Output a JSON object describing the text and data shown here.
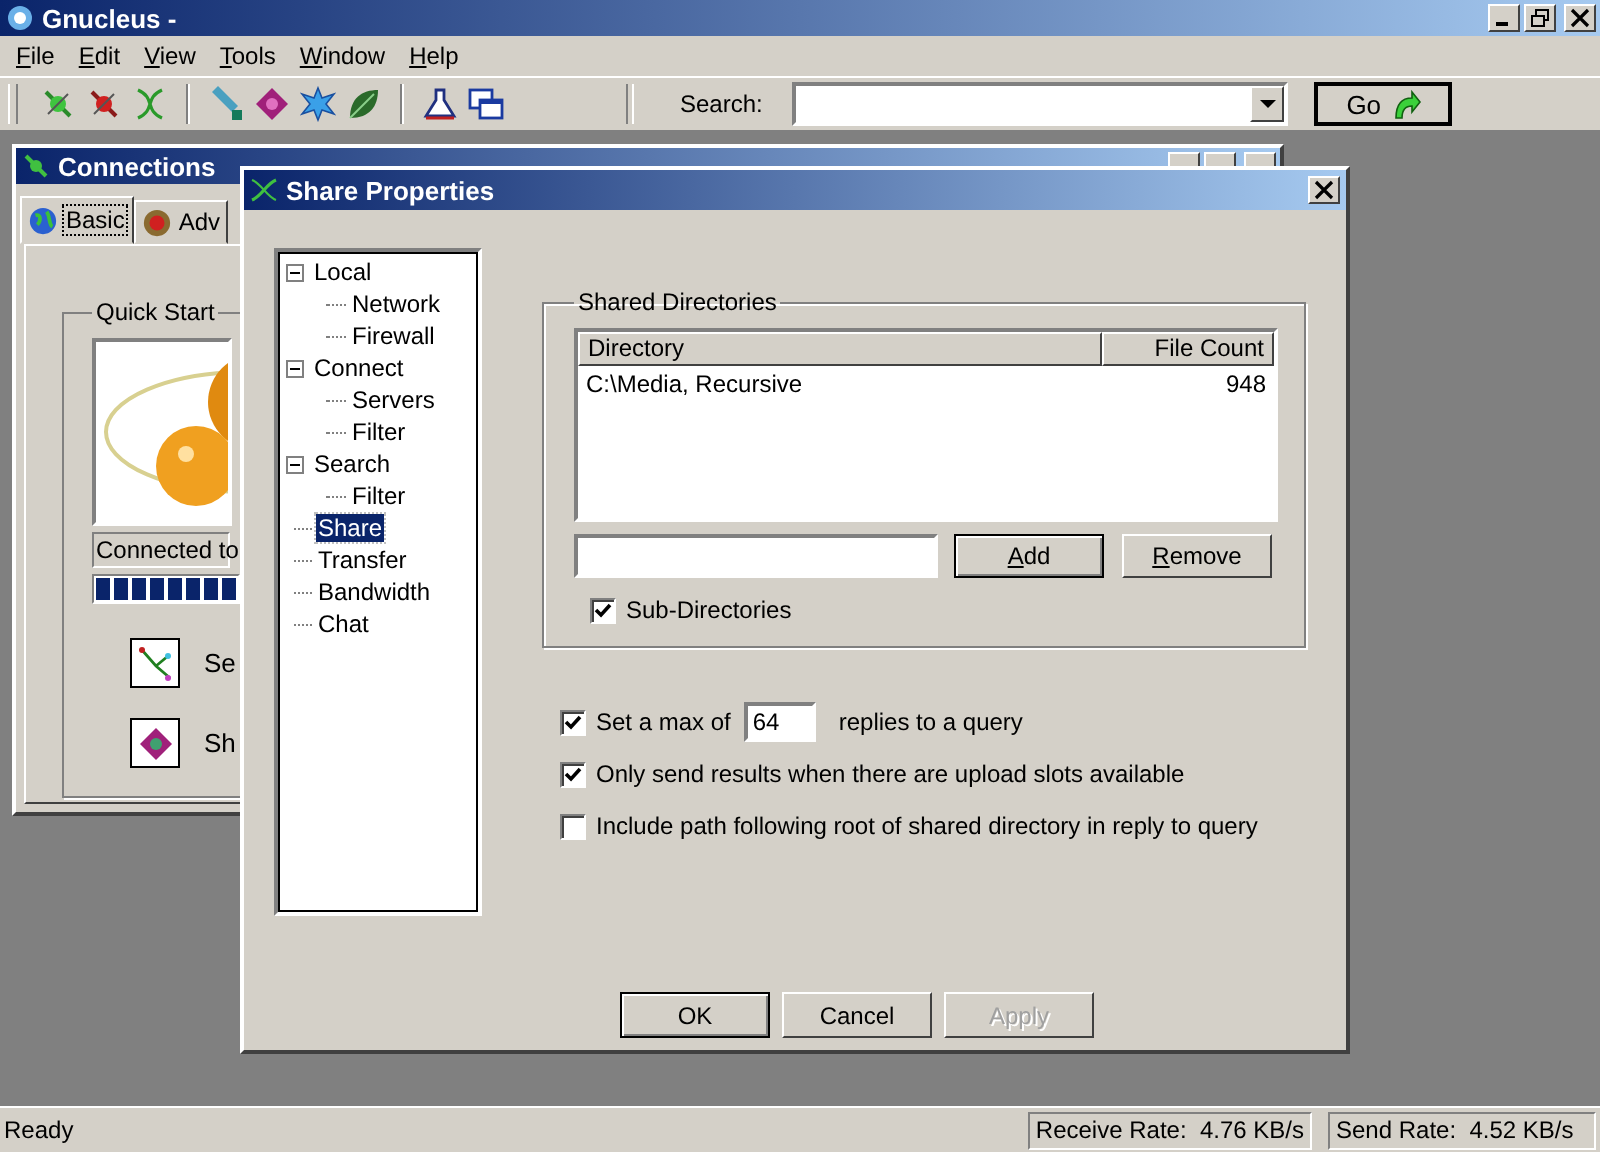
{
  "window": {
    "title": "Gnucleus -"
  },
  "menu": [
    {
      "label": "File"
    },
    {
      "label": "Edit"
    },
    {
      "label": "View"
    },
    {
      "label": "Tools"
    },
    {
      "label": "Window"
    },
    {
      "label": "Help"
    }
  ],
  "search": {
    "label": "Search:",
    "button": "Go"
  },
  "connections": {
    "title": "Connections",
    "tabs": [
      {
        "label": "Basic",
        "selected": true
      },
      {
        "label": "Adv",
        "selected": false
      }
    ],
    "quick_start": {
      "title": "Quick Start",
      "status": "Connected to",
      "level": 1,
      "actions": [
        {
          "label": "Se"
        },
        {
          "label": "Sh"
        }
      ]
    }
  },
  "dialog": {
    "title": "Share Properties",
    "tree": [
      {
        "label": "Local",
        "expanded": true,
        "selected": false,
        "children": [
          {
            "label": "Network",
            "selected": false
          },
          {
            "label": "Firewall",
            "selected": false
          }
        ]
      },
      {
        "label": "Connect",
        "expanded": true,
        "selected": false,
        "children": [
          {
            "label": "Servers",
            "selected": false
          },
          {
            "label": "Filter",
            "selected": false
          }
        ]
      },
      {
        "label": "Search",
        "expanded": true,
        "selected": false,
        "children": [
          {
            "label": "Filter",
            "selected": false
          }
        ]
      },
      {
        "label": "Share",
        "selected": true
      },
      {
        "label": "Transfer",
        "selected": false
      },
      {
        "label": "Bandwidth",
        "selected": false
      },
      {
        "label": "Chat",
        "selected": false
      }
    ],
    "shared_directories": {
      "title": "Shared Directories",
      "columns": [
        "Directory",
        "File Count"
      ],
      "rows": [
        {
          "directory": "C:\\Media, Recursive",
          "file_count": "948"
        }
      ],
      "buttons": [
        {
          "label": "Add",
          "default": true
        },
        {
          "label": "Remove",
          "default": false
        }
      ],
      "sub_directories": {
        "label": "Sub-Directories",
        "checked": true
      }
    },
    "options": [
      {
        "kind": "max",
        "checked": true,
        "label": "Set a max of",
        "value": "64",
        "suffix": "replies to a query"
      },
      {
        "kind": "check",
        "checked": true,
        "label": "Only send results when there are upload slots available"
      },
      {
        "kind": "check",
        "checked": false,
        "label": "Include path following root of shared directory in reply to query"
      }
    ],
    "buttons": [
      {
        "label": "OK",
        "default": true,
        "disabled": false
      },
      {
        "label": "Cancel",
        "default": false,
        "disabled": false
      },
      {
        "label": "Apply",
        "default": false,
        "disabled": true
      }
    ]
  },
  "status_bar": {
    "text": "Ready",
    "panels": [
      "Receive Rate:  4.76 KB/s",
      "Send Rate:  4.52 KB/s"
    ]
  }
}
